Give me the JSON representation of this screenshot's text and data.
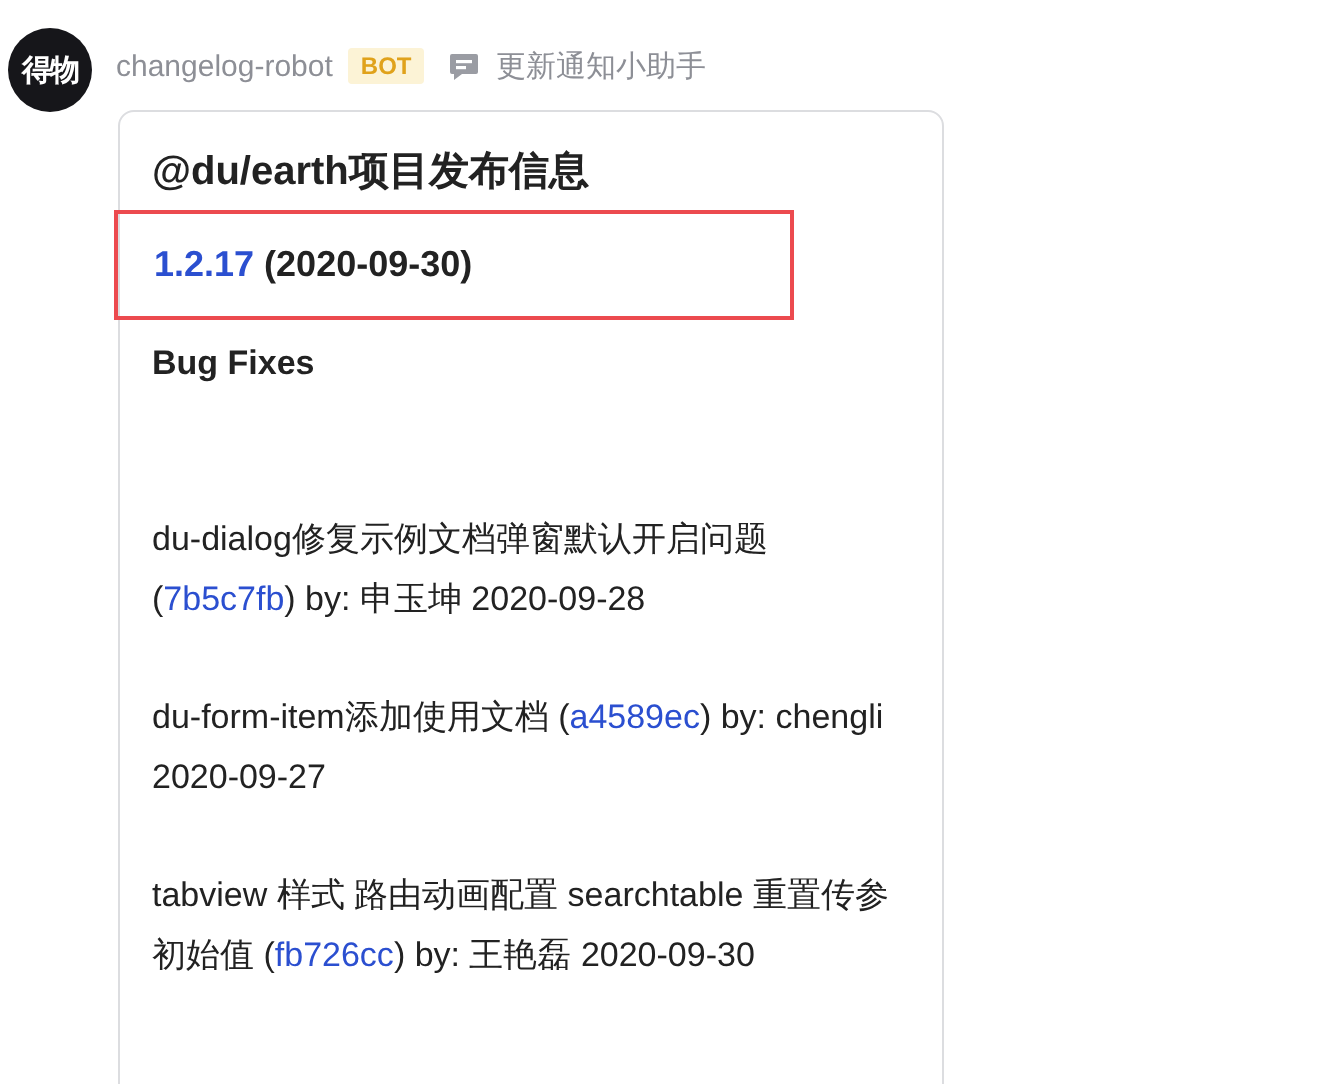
{
  "avatar": {
    "text": "得物"
  },
  "sender": {
    "name": "changelog-robot",
    "badge": "BOT",
    "app": "更新通知小助手"
  },
  "card": {
    "title": "@du/earth项目发布信息",
    "version": {
      "number": "1.2.17",
      "date": "(2020-09-30)",
      "highlighted": true
    },
    "section": "Bug Fixes",
    "entries": [
      {
        "text": "du-dialog修复示例文档弹窗默认开启问题 (",
        "commit": "7b5c7fb",
        "after": ") by: 申玉坤 2020-09-28"
      },
      {
        "text": "du-form-item添加使用文档 (",
        "commit": "a4589ec",
        "after": ") by: chengli 2020-09-27"
      },
      {
        "text": "tabview 样式 路由动画配置 searchtable 重置传参初始值 (",
        "commit": "fb726cc",
        "after": ") by: 王艳磊 2020-09-30"
      }
    ]
  }
}
